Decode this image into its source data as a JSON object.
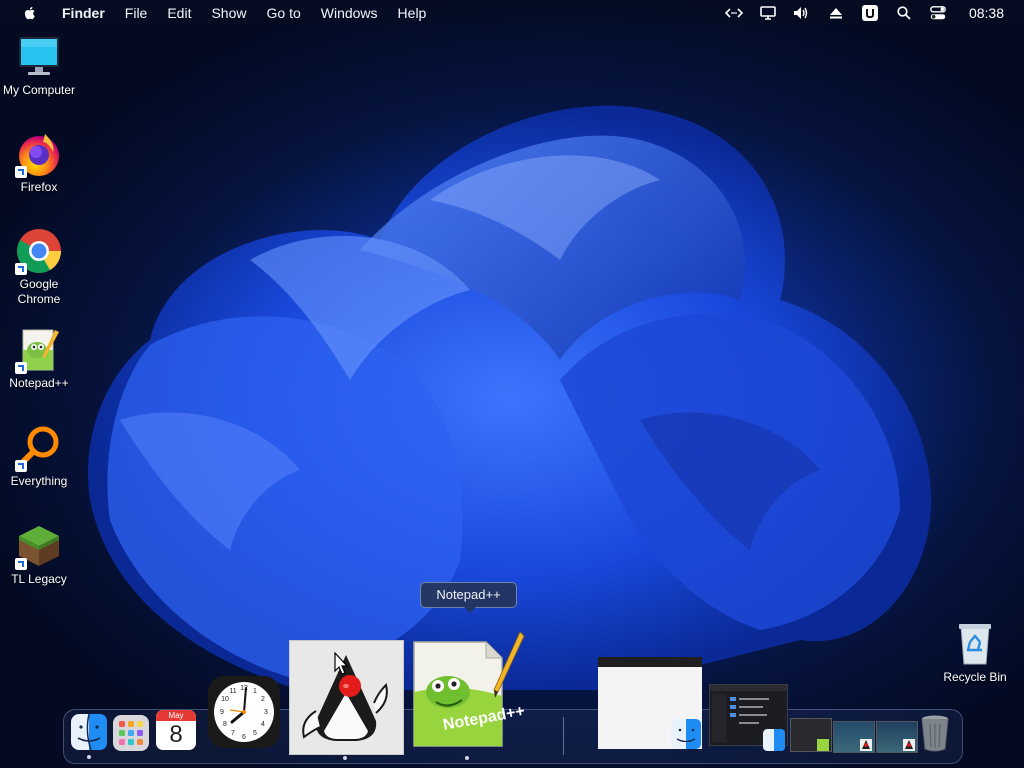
{
  "menubar": {
    "app_name": "Finder",
    "menus": [
      "File",
      "Edit",
      "Show",
      "Go to",
      "Windows",
      "Help"
    ],
    "status_icons": [
      "code-icon",
      "display-icon",
      "volume-icon",
      "eject-icon",
      "u-badge-icon",
      "search-icon",
      "control-center-icon"
    ],
    "clock": "08:38"
  },
  "desktop": {
    "icons": [
      {
        "label": "My Computer",
        "icon": "monitor-icon"
      },
      {
        "label": "Firefox",
        "icon": "firefox-icon"
      },
      {
        "label": "Google Chrome",
        "icon": "chrome-icon"
      },
      {
        "label": "Notepad++",
        "icon": "notepadpp-icon"
      },
      {
        "label": "Everything",
        "icon": "everything-icon"
      },
      {
        "label": "TL Legacy",
        "icon": "minecraft-icon"
      }
    ],
    "recycle_bin": {
      "label": "Recycle Bin",
      "icon": "recycle-bin-icon"
    }
  },
  "dock": {
    "tooltip": "Notepad++",
    "calendar": {
      "month": "May",
      "day": "8"
    },
    "items": [
      "finder",
      "launchpad",
      "calendar",
      "clock",
      "java-app",
      "notepadpp",
      "window-thumb-1",
      "window-thumb-2",
      "window-thumb-3",
      "window-thumb-4",
      "window-thumb-5",
      "trash"
    ]
  },
  "colors": {
    "accent": "#1a4ad8",
    "background": "#061440"
  }
}
